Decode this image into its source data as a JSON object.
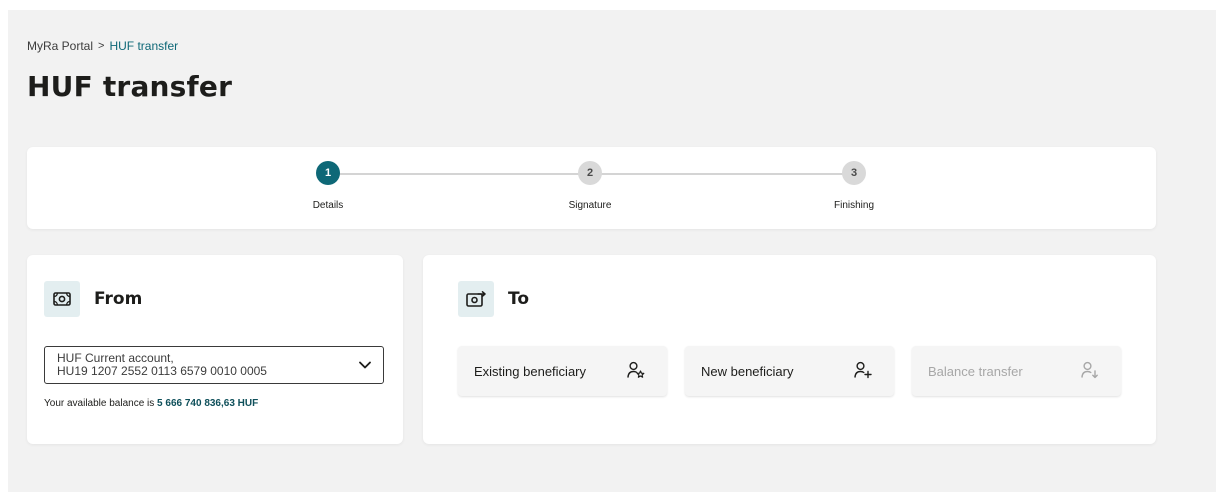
{
  "breadcrumb": {
    "items": [
      "MyRa Portal",
      "HUF transfer"
    ],
    "separator": ">"
  },
  "page": {
    "title": "HUF transfer"
  },
  "stepper": {
    "steps": [
      {
        "number": "1",
        "label": "Details",
        "state": "active"
      },
      {
        "number": "2",
        "label": "Signature",
        "state": "pending"
      },
      {
        "number": "3",
        "label": "Finishing",
        "state": "pending"
      }
    ]
  },
  "from": {
    "title": "From",
    "icon": "banknote-icon",
    "account_line1": "HUF Current account,",
    "account_line2": "HU19 1207 2552 0113 6579 0010 0005",
    "balance_prefix": "Your available balance is",
    "balance_amount": "5 666 740 836,63 HUF"
  },
  "to": {
    "title": "To",
    "icon": "banknote-transfer-icon",
    "options": [
      {
        "label": "Existing beneficiary",
        "icon": "user-star-icon",
        "enabled": true
      },
      {
        "label": "New beneficiary",
        "icon": "user-plus-icon",
        "enabled": true
      },
      {
        "label": "Balance transfer",
        "icon": "user-arrow-down-icon",
        "enabled": false
      }
    ]
  },
  "colors": {
    "accent": "#0e6877",
    "background": "#f2f2f2",
    "icon_box": "#e3eef0",
    "step_inactive": "#d9d9d9",
    "disabled_text": "#a7a7a7"
  }
}
